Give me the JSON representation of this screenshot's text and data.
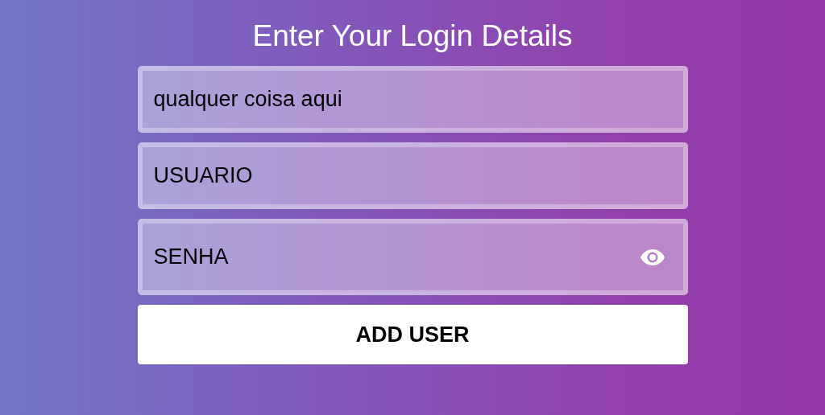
{
  "title": "Enter Your Login Details",
  "fields": [
    {
      "placeholder": "qualquer coisa aqui",
      "kind": "text"
    },
    {
      "placeholder": "USUARIO",
      "kind": "text"
    },
    {
      "placeholder": "SENHA",
      "kind": "password"
    }
  ],
  "button": "ADD USER"
}
